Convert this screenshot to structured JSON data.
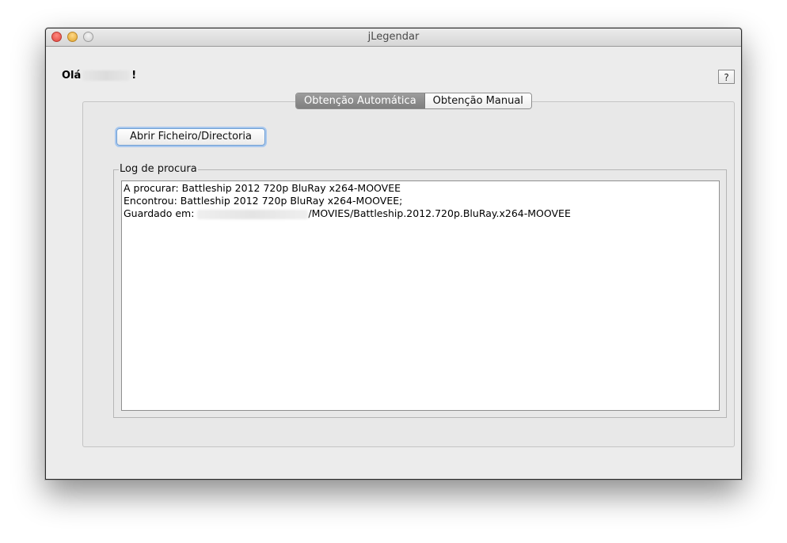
{
  "window": {
    "title": "jLegendar"
  },
  "greeting": {
    "prefix": "Olá",
    "suffix": "!"
  },
  "help_button": {
    "label": "?"
  },
  "tabs": [
    {
      "label": "Obtenção Automática",
      "active": true
    },
    {
      "label": "Obtenção Manual",
      "active": false
    }
  ],
  "open_button": {
    "label": "Abrir Ficheiro/Directoria"
  },
  "log": {
    "legend": "Log de procura",
    "lines": [
      "A procurar: Battleship 2012 720p BluRay x264-MOOVEE",
      "Encontrou: Battleship 2012 720p BluRay x264-MOOVEE;"
    ],
    "saved_prefix": "Guardado em: ",
    "saved_suffix": "/MOVIES/Battleship.2012.720p.BluRay.x264-MOOVEE"
  }
}
